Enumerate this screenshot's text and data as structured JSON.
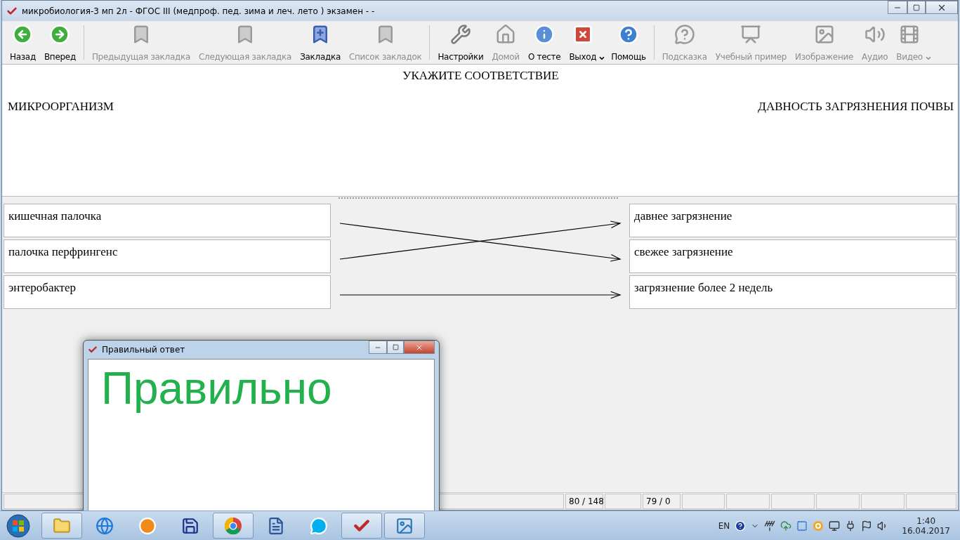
{
  "window": {
    "title": "микробиология-3 мп 2л - ФГОС III (медпроф. пед. зима и леч. лето ) экзамен -  -"
  },
  "toolbar": [
    [
      {
        "kind": "back",
        "label": "Назад",
        "disabled": false,
        "dropdown": false
      },
      {
        "kind": "forward",
        "label": "Вперед",
        "disabled": false,
        "dropdown": false
      }
    ],
    [
      {
        "kind": "prev-bookmark",
        "label": "Предыдущая закладка",
        "disabled": true,
        "dropdown": false
      },
      {
        "kind": "next-bookmark",
        "label": "Следующая закладка",
        "disabled": true,
        "dropdown": false
      },
      {
        "kind": "add-bookmark",
        "label": "Закладка",
        "disabled": false,
        "dropdown": false
      },
      {
        "kind": "bookmark-list",
        "label": "Список закладок",
        "disabled": true,
        "dropdown": false
      }
    ],
    [
      {
        "kind": "settings",
        "label": "Настройки",
        "disabled": false,
        "dropdown": false
      },
      {
        "kind": "home",
        "label": "Домой",
        "disabled": true,
        "dropdown": false
      },
      {
        "kind": "about",
        "label": "О тесте",
        "disabled": false,
        "dropdown": false
      },
      {
        "kind": "exit",
        "label": "Выход",
        "disabled": false,
        "dropdown": true
      },
      {
        "kind": "help",
        "label": "Помощь",
        "disabled": false,
        "dropdown": false
      }
    ],
    [
      {
        "kind": "hint",
        "label": "Подсказка",
        "disabled": true,
        "dropdown": false
      },
      {
        "kind": "example",
        "label": "Учебный пример",
        "disabled": true,
        "dropdown": false
      },
      {
        "kind": "image",
        "label": "Изображение",
        "disabled": true,
        "dropdown": false
      },
      {
        "kind": "audio",
        "label": "Аудио",
        "disabled": true,
        "dropdown": false
      },
      {
        "kind": "video",
        "label": "Видео",
        "disabled": true,
        "dropdown": true
      }
    ]
  ],
  "question": {
    "title": "УКАЖИТЕ СООТВЕТСТВИЕ",
    "left_heading": "МИКРООРГАНИЗМ",
    "right_heading": "ДАВНОСТЬ ЗАГРЯЗНЕНИЯ ПОЧВЫ"
  },
  "matching": {
    "left": [
      "кишечная палочка",
      "палочка перфрингенс",
      "энтеробактер"
    ],
    "right": [
      "давнее загрязнение",
      "свежее загрязнение",
      "загрязнение более 2 недель"
    ]
  },
  "status_bar": {
    "progress": "80 / 148",
    "score": "79 / 0"
  },
  "dialog": {
    "title": "Правильный ответ",
    "message": "Правильно"
  },
  "taskbar": {
    "apps": [
      {
        "kind": "explorer",
        "open": true
      },
      {
        "kind": "browser",
        "open": false
      },
      {
        "kind": "media",
        "open": false
      },
      {
        "kind": "floppy",
        "open": false
      },
      {
        "kind": "chrome",
        "open": true
      },
      {
        "kind": "word",
        "open": false
      },
      {
        "kind": "skype",
        "open": false
      },
      {
        "kind": "test-app",
        "open": true
      },
      {
        "kind": "photos",
        "open": true
      }
    ],
    "language": "EN",
    "time": "1:40",
    "date": "16.04.2017"
  }
}
